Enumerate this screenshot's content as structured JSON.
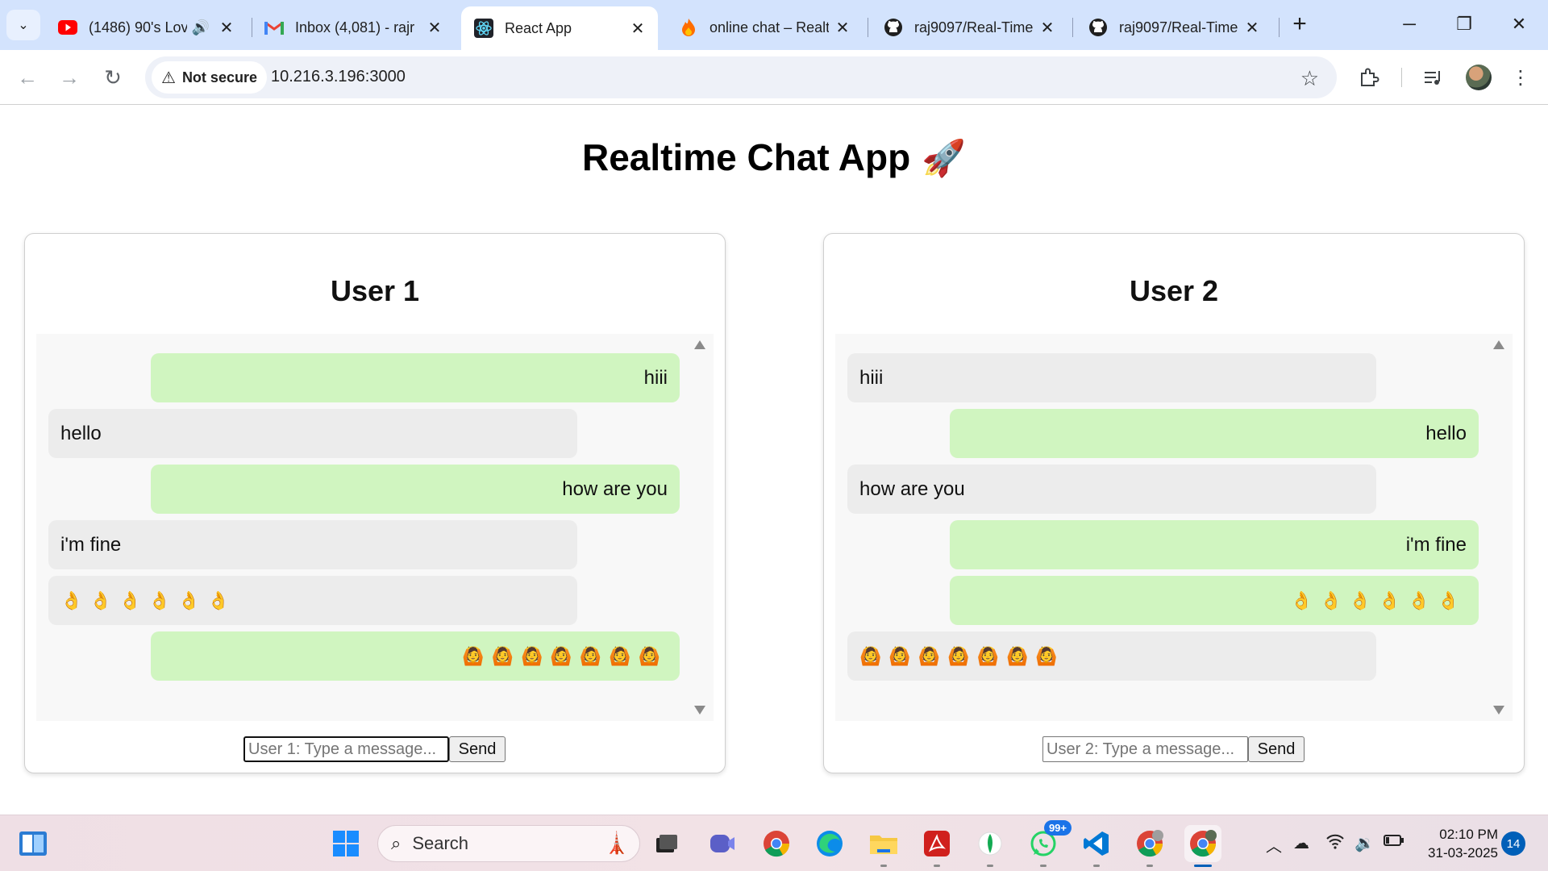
{
  "browser": {
    "tabs": [
      {
        "title": "(1486) 90's Lov",
        "favicon": "youtube-icon",
        "color": "#ff0000",
        "audio": true
      },
      {
        "title": "Inbox (4,081) - rajr",
        "favicon": "gmail-icon",
        "color": "#ea4335"
      },
      {
        "title": "React App",
        "favicon": "react-icon",
        "color": "#1f1f1f",
        "active": true
      },
      {
        "title": "online chat – Realt",
        "favicon": "fire-icon",
        "color": "#ff6d00"
      },
      {
        "title": "raj9097/Real-Time",
        "favicon": "github-icon",
        "color": "#1f1f1f"
      },
      {
        "title": "raj9097/Real-Time",
        "favicon": "github-icon",
        "color": "#1f1f1f"
      }
    ],
    "security_label": "Not secure",
    "url": "10.216.3.196:3000"
  },
  "app": {
    "title": "Realtime Chat App",
    "title_emoji": "🚀"
  },
  "users": [
    {
      "name": "User 1",
      "placeholder": "User 1: Type a message...",
      "send_label": "Send",
      "messages": [
        {
          "text": "hiii",
          "side": "sent"
        },
        {
          "text": "hello",
          "side": "received"
        },
        {
          "text": "how are you",
          "side": "sent"
        },
        {
          "text": "i'm fine",
          "side": "received"
        },
        {
          "text": "👌👌👌👌👌👌",
          "side": "received"
        },
        {
          "text": "🙆🙆🙆🙆🙆🙆🙆",
          "side": "sent"
        }
      ]
    },
    {
      "name": "User 2",
      "placeholder": "User 2: Type a message...",
      "send_label": "Send",
      "messages": [
        {
          "text": "hiii",
          "side": "received"
        },
        {
          "text": "hello",
          "side": "sent"
        },
        {
          "text": "how are you",
          "side": "received"
        },
        {
          "text": "i'm fine",
          "side": "sent"
        },
        {
          "text": "👌👌👌👌👌👌",
          "side": "sent"
        },
        {
          "text": "🙆🙆🙆🙆🙆🙆🙆",
          "side": "received"
        }
      ]
    }
  ],
  "colors": {
    "sent_bubble": "#d0f5c0",
    "received_bubble": "#ececec",
    "accent": "#005fb8"
  },
  "taskbar": {
    "search_label": "Search",
    "whatsapp_badge": "99+",
    "time": "02:10 PM",
    "date": "31-03-2025",
    "notification_count": "14"
  }
}
